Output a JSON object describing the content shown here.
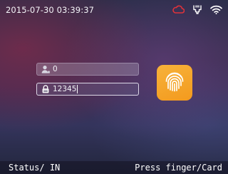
{
  "header": {
    "datetime": "2015-07-30 03:39:37",
    "icons": [
      "cloud-icon",
      "network-port-icon",
      "wifi-icon"
    ],
    "cloud_icon_color": "#e0323a"
  },
  "login": {
    "user_id_value": "0",
    "password_value": "12345",
    "user_icon": "user-icon",
    "password_icon": "lock-icon",
    "fingerprint_icon": "fingerprint-icon",
    "fingerprint_button_color": "#f5a52b"
  },
  "status_bar": {
    "label": "Status/",
    "value": "IN",
    "prompt": "Press finger/Card"
  }
}
